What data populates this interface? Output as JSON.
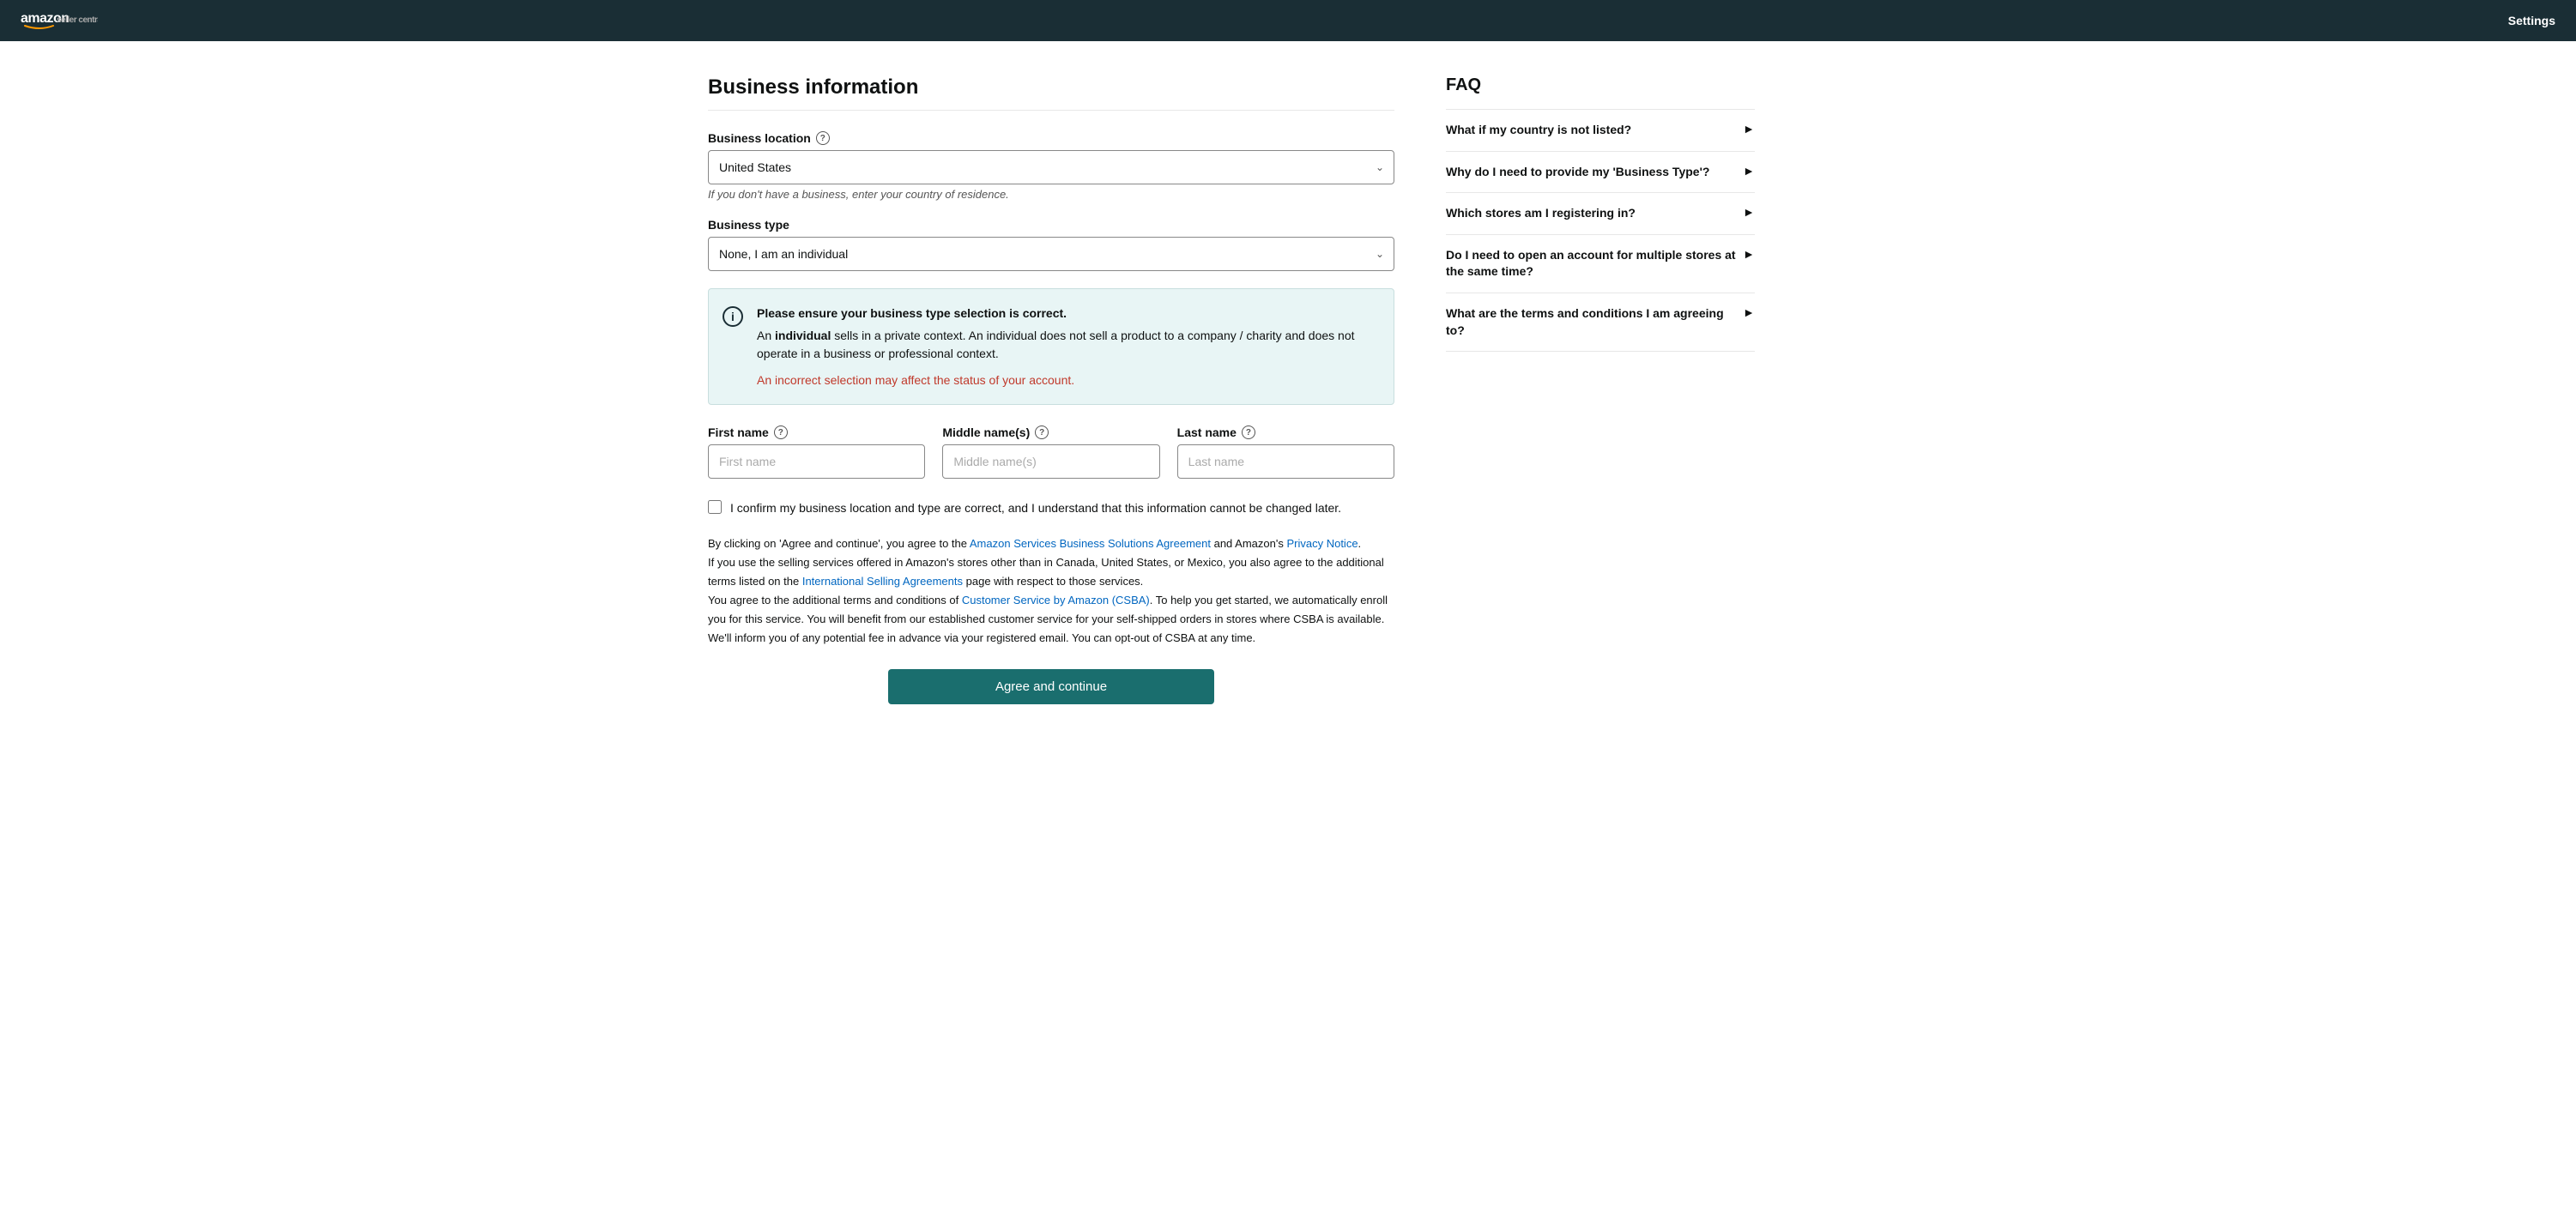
{
  "header": {
    "logo_amazon": "amazon",
    "logo_sc": "seller central",
    "settings_label": "Settings"
  },
  "page": {
    "title": "Business information"
  },
  "form": {
    "business_location": {
      "label": "Business location",
      "value": "United States",
      "hint": "If you don't have a business, enter your country of residence.",
      "options": [
        "United States"
      ]
    },
    "business_type": {
      "label": "Business type",
      "value": "None, I am an individual",
      "options": [
        "None, I am an individual"
      ]
    },
    "info_box": {
      "title": "Please ensure your business type selection is correct.",
      "body_prefix": "An ",
      "body_bold": "individual",
      "body_suffix": " sells in a private context. An individual does not sell a product to a company / charity and does not operate in a business or professional context.",
      "warning": "An incorrect selection may affect the status of your account."
    },
    "first_name": {
      "label": "First name",
      "placeholder": "First name"
    },
    "middle_name": {
      "label": "Middle name(s)",
      "placeholder": "Middle name(s)"
    },
    "last_name": {
      "label": "Last name",
      "placeholder": "Last name"
    },
    "checkbox_label": "I confirm my business location and type are correct, and I understand that this information cannot be changed later.",
    "legal": {
      "line1_prefix": "By clicking on 'Agree and continue', you agree to the ",
      "link1": "Amazon Services Business Solutions Agreement",
      "line1_mid": " and Amazon's ",
      "link2": "Privacy Notice",
      "line1_suffix": ".",
      "line2_prefix": "If you use the selling services offered in Amazon's stores other than in Canada, United States, or Mexico, you also agree to the additional terms listed on the ",
      "link3": "International Selling Agreements",
      "line2_suffix": " page with respect to those services.",
      "line3_prefix": "You agree to the additional terms and conditions of ",
      "link4": "Customer Service by Amazon (CSBA)",
      "line3_suffix": ". To help you get started, we automatically enroll you for this service. You will benefit from our established customer service for your self-shipped orders in stores where CSBA is available. We'll inform you of any potential fee in advance via your registered email. You can opt-out of CSBA at any time."
    },
    "submit_label": "Agree and continue"
  },
  "faq": {
    "title": "FAQ",
    "items": [
      {
        "question": "What if my country is not listed?"
      },
      {
        "question": "Why do I need to provide my 'Business Type'?"
      },
      {
        "question": "Which stores am I registering in?"
      },
      {
        "question": "Do I need to open an account for multiple stores at the same time?"
      },
      {
        "question": "What are the terms and conditions I am agreeing to?"
      }
    ]
  }
}
